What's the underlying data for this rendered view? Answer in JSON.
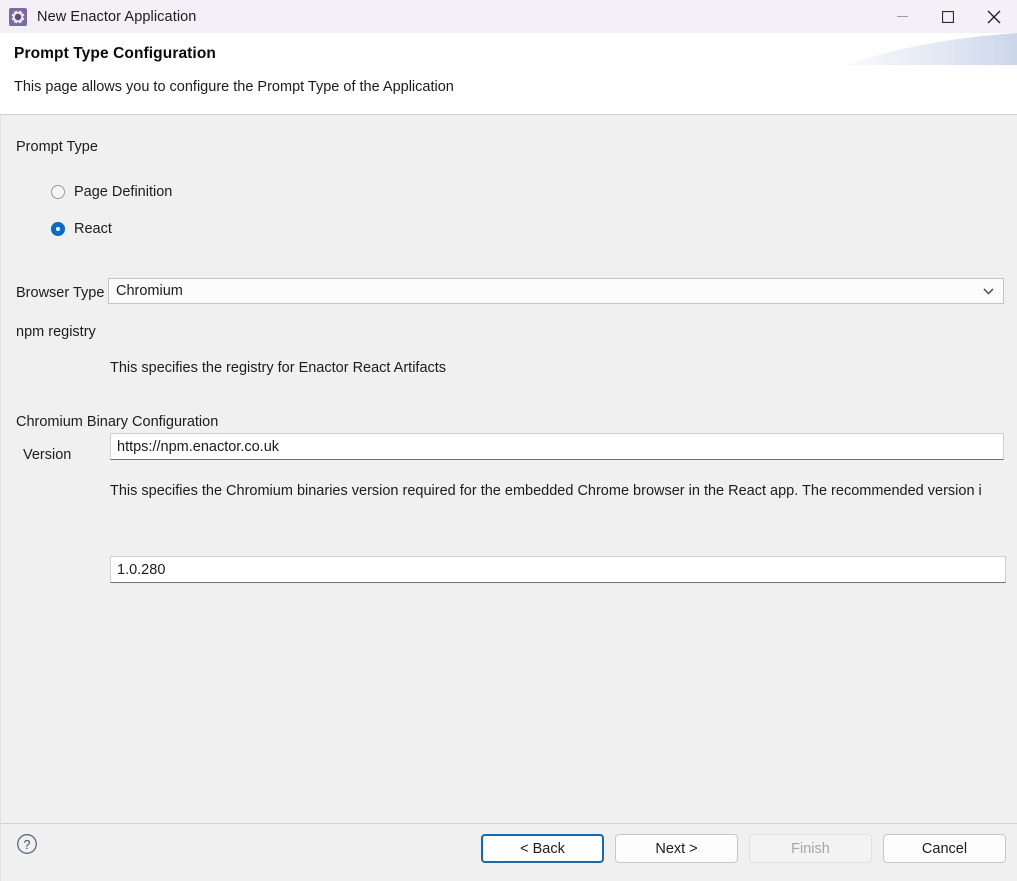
{
  "window": {
    "title": "New Enactor Application",
    "icon": "gear-icon",
    "controls": {
      "minimize": "minimize-icon",
      "maximize": "maximize-icon",
      "close": "close-icon"
    }
  },
  "header": {
    "title": "Prompt Type Configuration",
    "description": "This page allows you to configure the Prompt Type of the Application"
  },
  "body": {
    "prompt_type_group_label": "Prompt Type",
    "radios": [
      {
        "label": "Page Definition",
        "selected": false
      },
      {
        "label": "React",
        "selected": true
      }
    ],
    "browser_type": {
      "label": "Browser Type",
      "value": "Chromium",
      "arrow_icon": "chevron-down-icon"
    },
    "npm_registry": {
      "label": "npm registry",
      "value": "https://npm.enactor.co.uk",
      "placeholder": "",
      "hint": "This specifies the registry for Enactor React Artifacts"
    },
    "chromium_group_label": "Chromium Binary Configuration",
    "version": {
      "label": "Version",
      "value": "1.0.280",
      "placeholder": "",
      "hint": "This specifies the Chromium binaries version required for the embedded Chrome browser in the React app. The recommended version i"
    }
  },
  "footer": {
    "help_icon": "help-circle-icon",
    "buttons": [
      {
        "label": "< Back",
        "state": "focused"
      },
      {
        "label": "Next >",
        "state": "enabled"
      },
      {
        "label": "Finish",
        "state": "disabled"
      },
      {
        "label": "Cancel",
        "state": "enabled"
      }
    ]
  },
  "colors": {
    "accent": "#0a6cc8",
    "focus_border": "#1769b4",
    "titlebar": "#f4f0f7",
    "body": "#f0f0f0",
    "icon_purple": "#7b6a9b"
  }
}
